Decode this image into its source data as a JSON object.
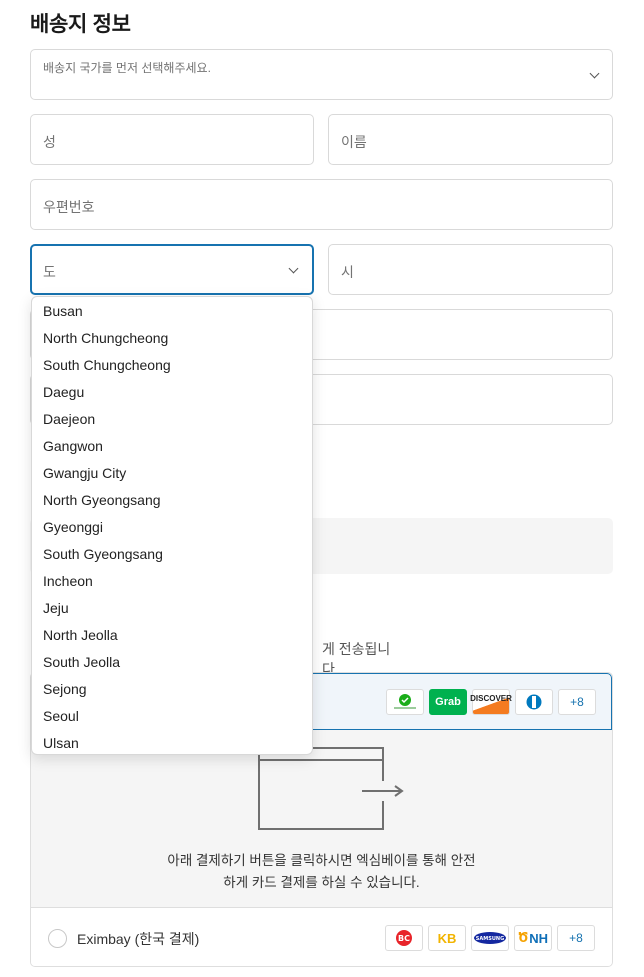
{
  "title": "배송지 정보",
  "fields": {
    "country_placeholder": "배송지 국가를 먼저 선택해주세요.",
    "last_name": "성",
    "first_name": "이름",
    "postal_code": "우편번호",
    "province": "도",
    "city": "시"
  },
  "dropdown": {
    "options": [
      "Busan",
      "North Chungcheong",
      "South Chungcheong",
      "Daegu",
      "Daejeon",
      "Gangwon",
      "Gwangju City",
      "North Gyeongsang",
      "Gyeonggi",
      "South Gyeongsang",
      "Incheon",
      "Jeju",
      "North Jeolla",
      "South Jeolla",
      "Sejong",
      "Seoul",
      "Ulsan"
    ]
  },
  "notice_tail": "게 전송됩니다.",
  "payment": {
    "card_badges": [
      "WeChat Pay",
      "Grab",
      "DISCOVER",
      "Diners"
    ],
    "card_more": "+8",
    "description_line1": "아래 결제하기 버튼을 클릭하시면 엑심베이를 통해 안전",
    "description_line2": "하게 카드 결제를 하실 수 있습니다.",
    "eximbay_label": "Eximbay (한국 결제)",
    "kr_badges": [
      "BC",
      "KB",
      "SAMSUNG",
      "NH"
    ],
    "kr_more": "+8"
  }
}
